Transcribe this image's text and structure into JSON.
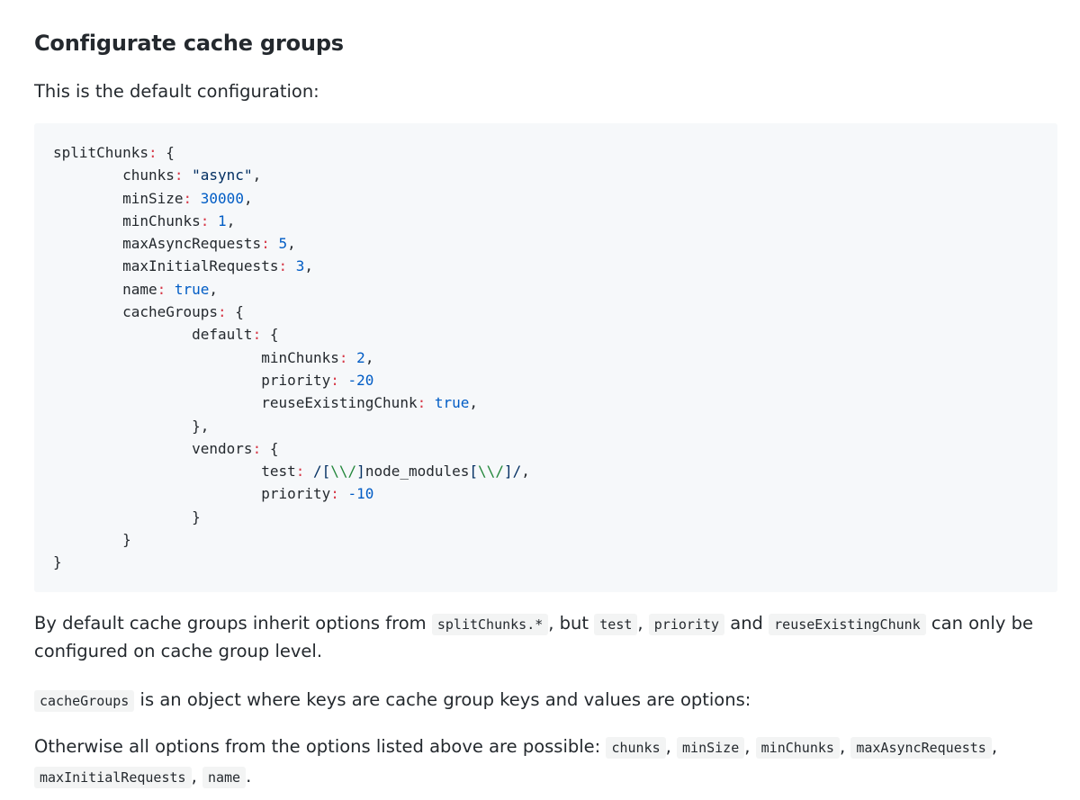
{
  "heading": "Configurate cache groups",
  "intro": "This is the default configuration:",
  "code_lines": [
    [
      {
        "t": "splitChunks"
      },
      {
        "t": ":",
        "c": "k"
      },
      {
        "t": " {"
      }
    ],
    [
      {
        "t": "        chunks"
      },
      {
        "t": ":",
        "c": "k"
      },
      {
        "t": " "
      },
      {
        "t": "\"async\"",
        "c": "s"
      },
      {
        "t": ","
      }
    ],
    [
      {
        "t": "        minSize"
      },
      {
        "t": ":",
        "c": "k"
      },
      {
        "t": " "
      },
      {
        "t": "30000",
        "c": "n"
      },
      {
        "t": ","
      }
    ],
    [
      {
        "t": "        minChunks"
      },
      {
        "t": ":",
        "c": "k"
      },
      {
        "t": " "
      },
      {
        "t": "1",
        "c": "n"
      },
      {
        "t": ","
      }
    ],
    [
      {
        "t": "        maxAsyncRequests"
      },
      {
        "t": ":",
        "c": "k"
      },
      {
        "t": " "
      },
      {
        "t": "5",
        "c": "n"
      },
      {
        "t": ","
      }
    ],
    [
      {
        "t": "        maxInitialRequests"
      },
      {
        "t": ":",
        "c": "k"
      },
      {
        "t": " "
      },
      {
        "t": "3",
        "c": "n"
      },
      {
        "t": ","
      }
    ],
    [
      {
        "t": "        name"
      },
      {
        "t": ":",
        "c": "k"
      },
      {
        "t": " "
      },
      {
        "t": "true",
        "c": "n"
      },
      {
        "t": ","
      }
    ],
    [
      {
        "t": "        cacheGroups"
      },
      {
        "t": ":",
        "c": "k"
      },
      {
        "t": " {"
      }
    ],
    [
      {
        "t": "                default"
      },
      {
        "t": ":",
        "c": "k"
      },
      {
        "t": " {"
      }
    ],
    [
      {
        "t": "                        minChunks"
      },
      {
        "t": ":",
        "c": "k"
      },
      {
        "t": " "
      },
      {
        "t": "2",
        "c": "n"
      },
      {
        "t": ","
      }
    ],
    [
      {
        "t": "                        priority"
      },
      {
        "t": ":",
        "c": "k"
      },
      {
        "t": " "
      },
      {
        "t": "-20",
        "c": "n"
      }
    ],
    [
      {
        "t": "                        reuseExistingChunk"
      },
      {
        "t": ":",
        "c": "k"
      },
      {
        "t": " "
      },
      {
        "t": "true",
        "c": "n"
      },
      {
        "t": ","
      }
    ],
    [
      {
        "t": "                },"
      }
    ],
    [
      {
        "t": "                vendors"
      },
      {
        "t": ":",
        "c": "k"
      },
      {
        "t": " {"
      }
    ],
    [
      {
        "t": "                        test"
      },
      {
        "t": ":",
        "c": "k"
      },
      {
        "t": " "
      },
      {
        "t": "/[",
        "c": "s"
      },
      {
        "t": "\\\\/",
        "c": "r"
      },
      {
        "t": "]",
        "c": "s"
      },
      {
        "t": "node_modules"
      },
      {
        "t": "[",
        "c": "s"
      },
      {
        "t": "\\\\/",
        "c": "r"
      },
      {
        "t": "]/",
        "c": "s"
      },
      {
        "t": ","
      }
    ],
    [
      {
        "t": "                        priority"
      },
      {
        "t": ":",
        "c": "k"
      },
      {
        "t": " "
      },
      {
        "t": "-10",
        "c": "n"
      }
    ],
    [
      {
        "t": "                }"
      }
    ],
    [
      {
        "t": "        }"
      }
    ],
    [
      {
        "t": "}"
      }
    ]
  ],
  "p2": {
    "a": "By default cache groups inherit options from ",
    "code1": "splitChunks.*",
    "b": ", but ",
    "code2": "test",
    "c": ", ",
    "code3": "priority",
    "d": " and ",
    "code4": "reuseExistingChunk",
    "e": " can only be configured on cache group level."
  },
  "p3": {
    "code1": "cacheGroups",
    "a": " is an object where keys are cache group keys and values are options:"
  },
  "p4": {
    "a": "Otherwise all options from the options listed above are possible: ",
    "code1": "chunks",
    "b": ", ",
    "code2": "minSize",
    "c": ", ",
    "code3": "minChunks",
    "d": ", ",
    "code4": "maxAsyncRequests",
    "e": ", ",
    "code5": "maxInitialRequests",
    "f": ", ",
    "code6": "name",
    "g": "."
  }
}
